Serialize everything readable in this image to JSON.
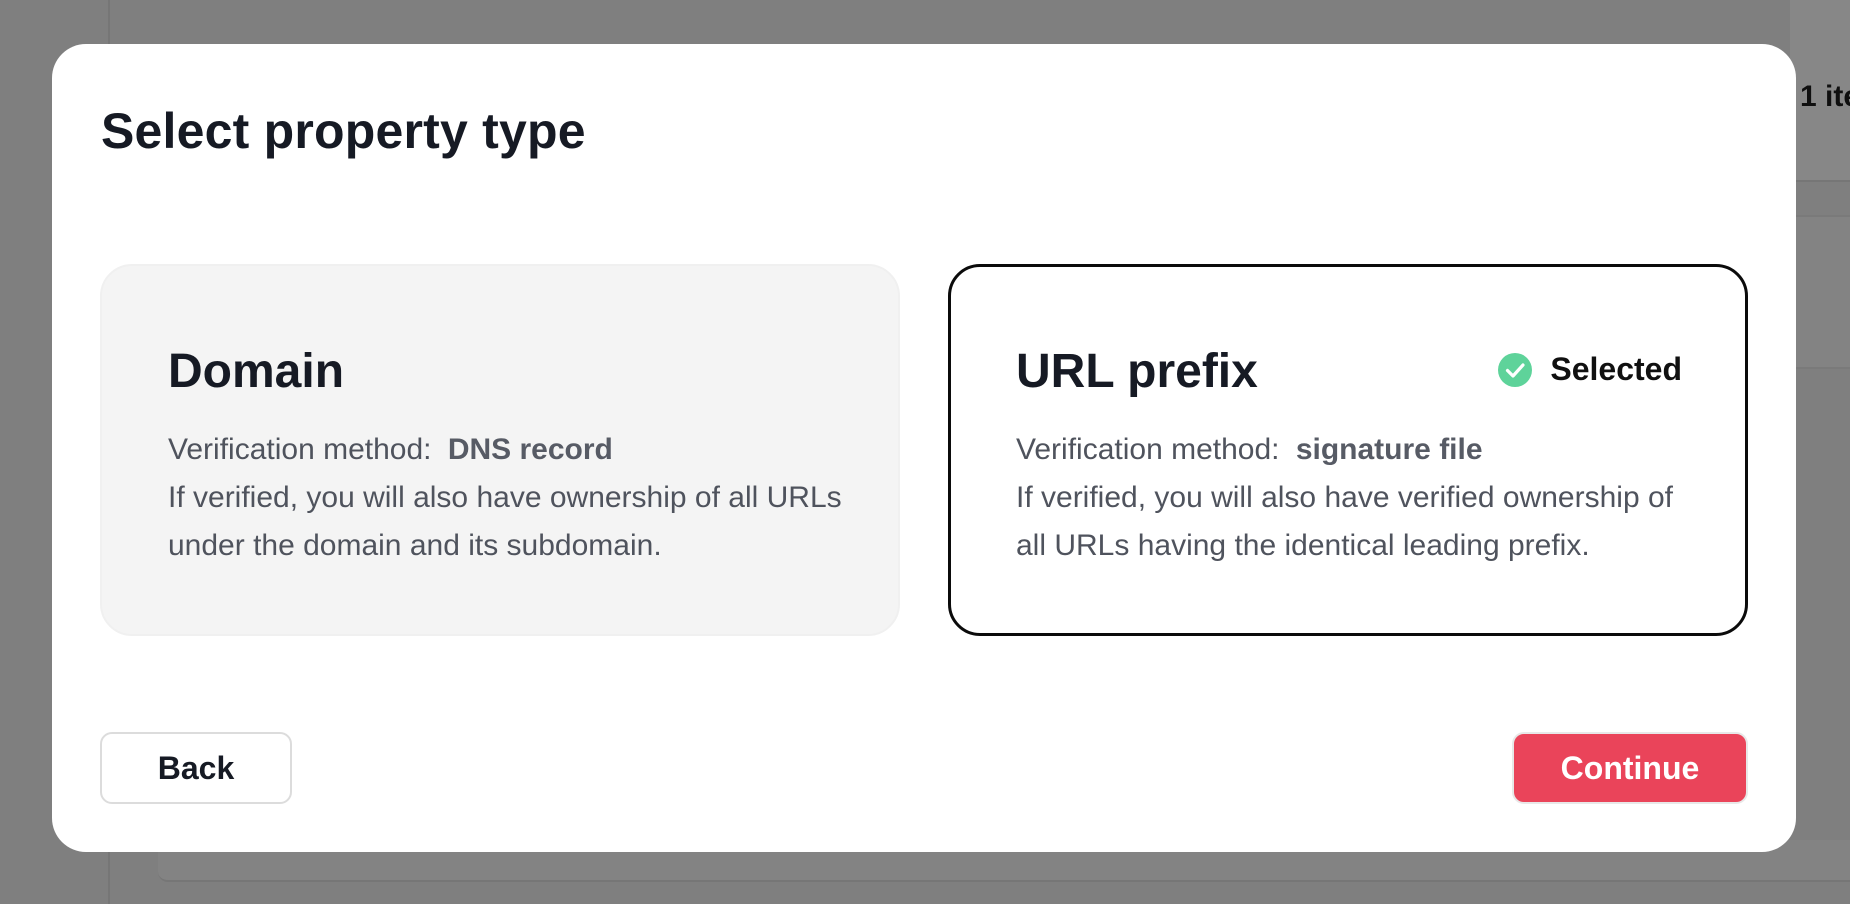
{
  "background": {
    "item_count_text": "1 ite"
  },
  "modal": {
    "title": "Select property type",
    "options": [
      {
        "title": "Domain",
        "method_label": "Verification method:",
        "method_value": "DNS record",
        "description": "If verified, you will also have ownership of all URLs under the domain and its subdomain.",
        "selected": false
      },
      {
        "title": "URL prefix",
        "method_label": "Verification method:",
        "method_value": "signature file",
        "description": "If verified, you will also have verified ownership of all URLs having the identical leading prefix.",
        "selected": true,
        "selected_label": "Selected",
        "selected_icon": "check-circle-icon"
      }
    ],
    "back_label": "Back",
    "continue_label": "Continue"
  },
  "colors": {
    "accent": "#ea445a",
    "check": "#5ed39a",
    "overlay": "#7f7f7f"
  }
}
